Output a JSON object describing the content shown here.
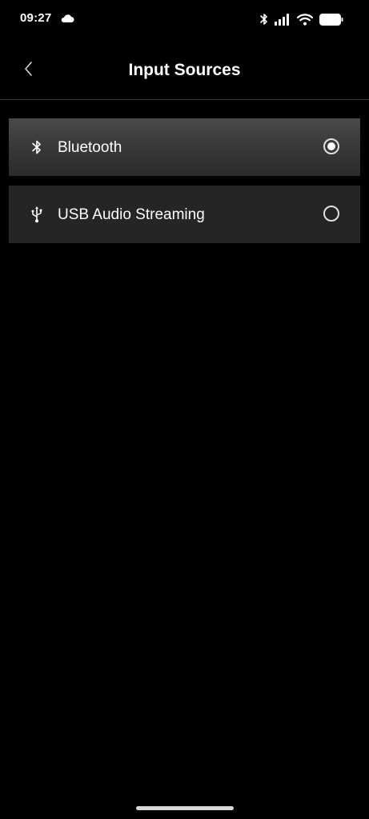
{
  "status_bar": {
    "time": "09:27",
    "icons": [
      "cloud-icon",
      "bluetooth-icon",
      "signal-icon",
      "wifi-icon",
      "battery-icon"
    ]
  },
  "header": {
    "title": "Input Sources",
    "back_icon": "chevron-left-icon"
  },
  "sources": [
    {
      "label": "Bluetooth",
      "icon": "bluetooth-icon",
      "selected": true
    },
    {
      "label": "USB Audio Streaming",
      "icon": "usb-icon",
      "selected": false
    }
  ],
  "colors": {
    "background": "#000000",
    "item_background": "#252525",
    "item_selected_background": "#3a3a3a",
    "text": "#ffffff",
    "divider": "#3a3a3a"
  }
}
